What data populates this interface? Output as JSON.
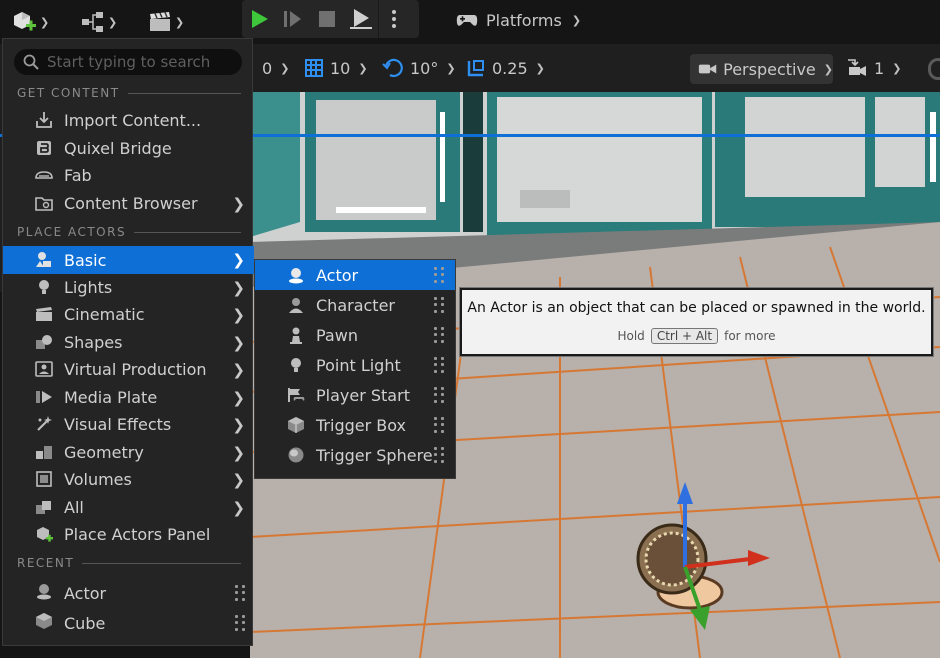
{
  "toolbar": {
    "platforms_label": "Platforms"
  },
  "viewport_toolbar": {
    "angle_value": "0",
    "grid_snap_value": "10",
    "rotation_snap_value": "10°",
    "scale_snap_value": "0.25",
    "perspective_label": "Perspective",
    "camera_speed_value": "1"
  },
  "menu": {
    "search_placeholder": "Start typing to search",
    "sections": {
      "get_content": "GET CONTENT",
      "place_actors": "PLACE ACTORS",
      "recent": "RECENT"
    },
    "get_content_items": [
      {
        "label": "Import Content...",
        "icon": "import-icon"
      },
      {
        "label": "Quixel Bridge",
        "icon": "bridge-icon"
      },
      {
        "label": "Fab",
        "icon": "fab-icon"
      },
      {
        "label": "Content Browser",
        "icon": "content-browser-icon"
      }
    ],
    "place_actors_items": [
      {
        "label": "Basic",
        "icon": "basic-shapes-icon",
        "selected": true
      },
      {
        "label": "Lights",
        "icon": "light-bulb-icon"
      },
      {
        "label": "Cinematic",
        "icon": "clapperboard-icon"
      },
      {
        "label": "Shapes",
        "icon": "shapes-icon"
      },
      {
        "label": "Virtual Production",
        "icon": "virtual-production-icon"
      },
      {
        "label": "Media Plate",
        "icon": "media-plate-icon"
      },
      {
        "label": "Visual Effects",
        "icon": "visual-effects-icon"
      },
      {
        "label": "Geometry",
        "icon": "geometry-icon"
      },
      {
        "label": "Volumes",
        "icon": "volumes-icon"
      },
      {
        "label": "All",
        "icon": "all-icon"
      },
      {
        "label": "Place Actors Panel",
        "icon": "place-actors-panel-icon"
      }
    ],
    "recent_items": [
      {
        "label": "Actor",
        "icon": "actor-icon"
      },
      {
        "label": "Cube",
        "icon": "cube-icon"
      }
    ]
  },
  "submenu": {
    "items": [
      {
        "label": "Actor",
        "icon": "actor-icon",
        "selected": true
      },
      {
        "label": "Character",
        "icon": "character-icon"
      },
      {
        "label": "Pawn",
        "icon": "pawn-icon"
      },
      {
        "label": "Point Light",
        "icon": "point-light-icon"
      },
      {
        "label": "Player Start",
        "icon": "player-start-icon"
      },
      {
        "label": "Trigger Box",
        "icon": "trigger-box-icon"
      },
      {
        "label": "Trigger Sphere",
        "icon": "trigger-sphere-icon"
      }
    ]
  },
  "tooltip": {
    "description": "An Actor is an object that can be placed or spawned in the world.",
    "hold_label": "Hold",
    "shortcut": "Ctrl + Alt",
    "more_label": "for more"
  },
  "colors": {
    "selection_blue": "#0e6fd6",
    "play_green": "#3ec73a",
    "grid_orange": "#d8762e",
    "panel_teal": "#2e7d7a"
  }
}
